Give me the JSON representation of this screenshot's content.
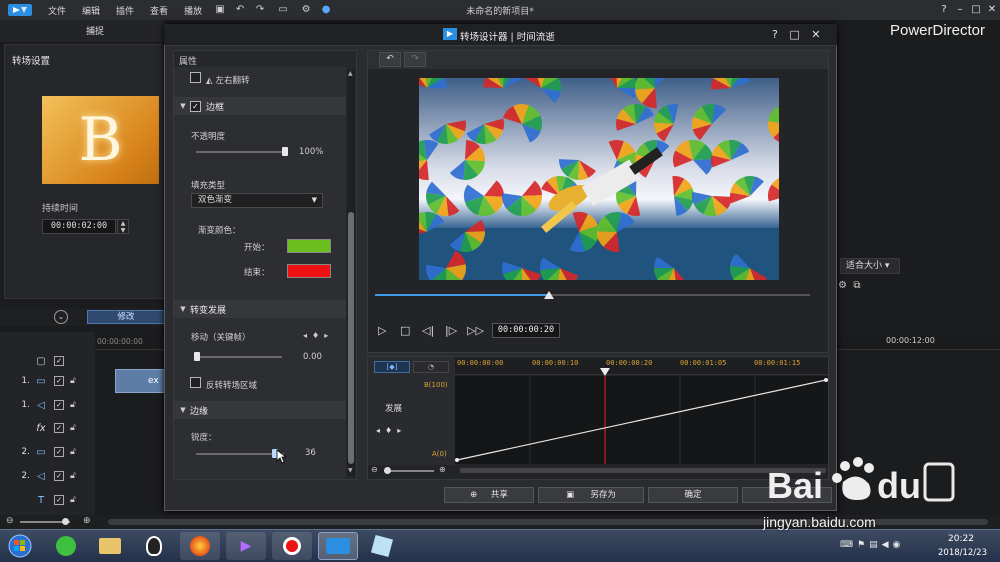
{
  "app": {
    "menu": [
      "文件",
      "编辑",
      "插件",
      "查看",
      "播放"
    ],
    "project_title": "未命名的新项目*",
    "brand": "PowerDirector",
    "window_controls": [
      "?",
      "–",
      "□",
      "✕"
    ],
    "capture_tab": "捕捉"
  },
  "left_panel": {
    "title": "转场设置",
    "thumb_letter": "B",
    "duration_label": "持续时间",
    "duration_value": "00:00:02:00",
    "modify_button": "修改"
  },
  "main_timeline": {
    "ruler_start": "00:00:00:00",
    "ruler_end": "00:00:12:00",
    "clip_label": "ex",
    "tracks": [
      {
        "num": "1.",
        "icon": "▭"
      },
      {
        "num": "1.",
        "icon": "◁"
      },
      {
        "num": "",
        "icon": "fx"
      },
      {
        "num": "2.",
        "icon": "▭"
      },
      {
        "num": "2.",
        "icon": "◁"
      },
      {
        "num": "",
        "icon": "T"
      }
    ],
    "fit_select": "适合大小"
  },
  "dialog": {
    "title": "转场设计器 | 时间流逝",
    "controls": [
      "?",
      "□",
      "✕"
    ],
    "properties_title": "属性",
    "flip_label": "左右翻转",
    "border_section": "边框",
    "opacity_label": "不透明度",
    "opacity_value": "100%",
    "opacity_pct": 100,
    "fill_type_label": "填充类型",
    "fill_type_value": "双色渐变",
    "gradient_label": "渐变颜色：",
    "start_label": "开始：",
    "end_label": "结束：",
    "start_color": "#6bbf1f",
    "end_color": "#ee1111",
    "progress_section": "转变发展",
    "move_label": "移动（关键帧）",
    "move_value": "0.00",
    "move_pct": 0,
    "reverse_label": "反转转场区域",
    "edge_section": "边缘",
    "sharpness_label": "锐度：",
    "sharpness_value": "36",
    "timecode": "00:00:00:20",
    "scrub_pct": 40,
    "kf_times": [
      "00:00:00:00",
      "00:00:00:10",
      "00:00:00:20",
      "00:00:01:05",
      "00:00:01:15"
    ],
    "kf_develop": "发展",
    "kf_b": "B(100)",
    "kf_a": "A(0)",
    "buttons": {
      "share": "共享",
      "save_as": "另存为",
      "ok": "确定"
    }
  },
  "taskbar": {
    "clock_time": "20:22",
    "clock_date": "2018/12/23"
  },
  "watermark": {
    "text": "jingyan.baidu.com"
  }
}
